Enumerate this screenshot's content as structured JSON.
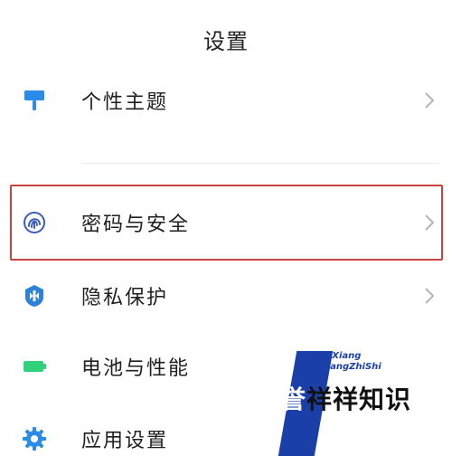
{
  "header": {
    "title": "设置"
  },
  "settings": {
    "items": [
      {
        "label": "个性主题",
        "icon": "paint-roller-icon",
        "color": "#2a8ce8"
      },
      {
        "label": "密码与安全",
        "icon": "fingerprint-icon",
        "color": "#3a5bb8"
      },
      {
        "label": "隐私保护",
        "icon": "shield-icon",
        "color": "#2b82d6"
      },
      {
        "label": "电池与性能",
        "icon": "battery-icon",
        "color": "#2fd17a"
      },
      {
        "label": "应用设置",
        "icon": "gear-icon",
        "color": "#2a8ce8"
      }
    ]
  },
  "watermark": {
    "latin_line1": "YuXiang",
    "latin_line2": "XiangZhiShi",
    "chinese_a": "誉",
    "chinese_b": "祥祥知识"
  },
  "colors": {
    "highlight_border": "#c9423d",
    "chevron": "#b5b5b5",
    "watermark_blue": "#1a3fa8"
  }
}
